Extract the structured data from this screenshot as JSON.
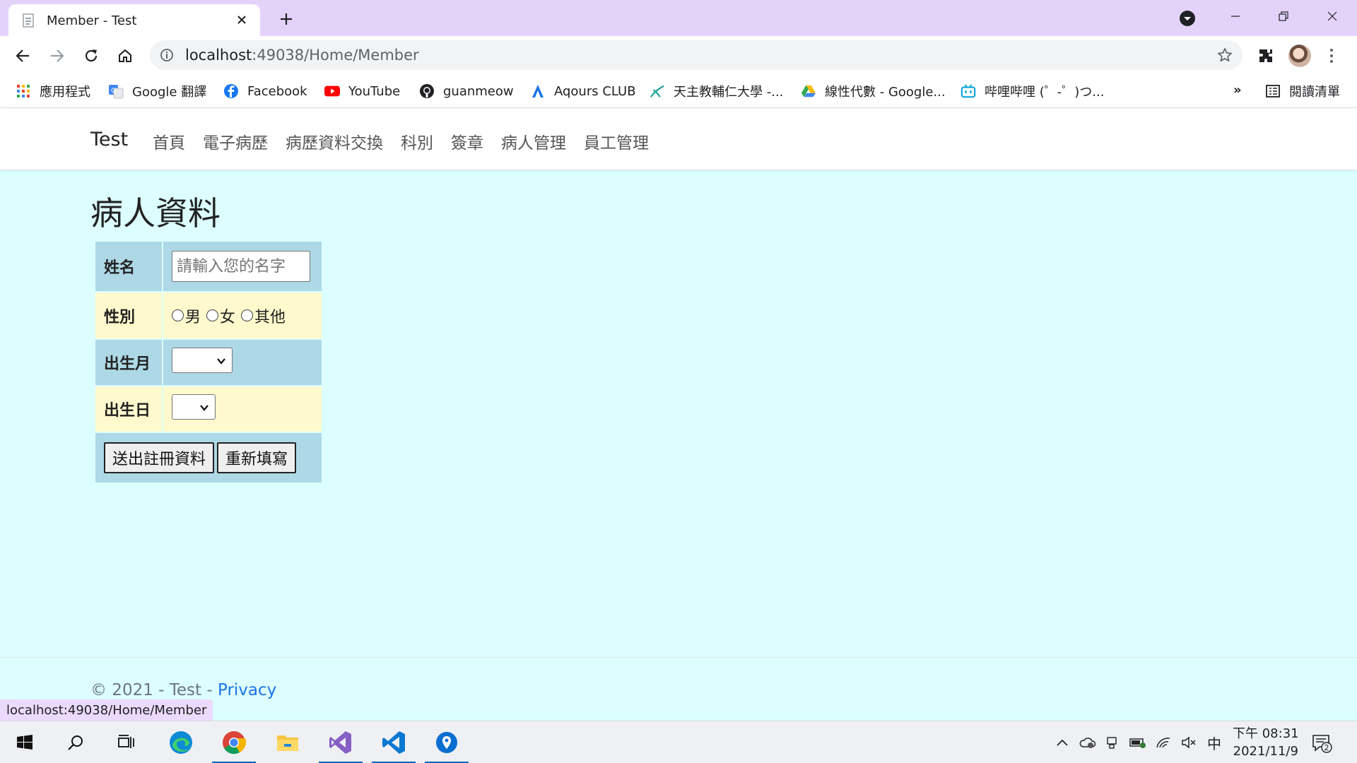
{
  "browser": {
    "tab_title": "Member - Test",
    "url_host": "localhost",
    "url_rest": ":49038/Home/Member",
    "bookmarks": [
      {
        "label": "應用程式",
        "icon": "apps-grid-icon"
      },
      {
        "label": "Google 翻譯",
        "icon": "google-translate-icon"
      },
      {
        "label": "Facebook",
        "icon": "facebook-icon"
      },
      {
        "label": "YouTube",
        "icon": "youtube-icon"
      },
      {
        "label": "guanmeow",
        "icon": "github-icon"
      },
      {
        "label": "Aqours CLUB",
        "icon": "aqours-icon"
      },
      {
        "label": "天主教輔仁大學 -...",
        "icon": "fju-icon"
      },
      {
        "label": "線性代數 - Google...",
        "icon": "google-drive-icon"
      },
      {
        "label": "哔哩哔哩 (゜-゜)つ...",
        "icon": "bilibili-icon"
      }
    ],
    "more_label": "»",
    "reading_list_label": "閱讀清單",
    "status_url": "localhost:49038/Home/Member"
  },
  "site": {
    "brand": "Test",
    "nav": [
      "首頁",
      "電子病歷",
      "病歷資料交換",
      "科別",
      "簽章",
      "病人管理",
      "員工管理"
    ]
  },
  "form": {
    "heading": "病人資料",
    "name_label": "姓名",
    "name_placeholder": "請輸入您的名字",
    "gender_label": "性別",
    "gender_options": [
      "男",
      "女",
      "其他"
    ],
    "birth_month_label": "出生月",
    "birth_day_label": "出生日",
    "submit_label": "送出註冊資料",
    "reset_label": "重新填寫"
  },
  "footer": {
    "copyright": "© 2021 - Test - ",
    "privacy_link": "Privacy"
  },
  "taskbar": {
    "ime": "中",
    "time": "下午 08:31",
    "date": "2021/11/9",
    "notification_count": "2"
  },
  "colors": {
    "page_bg": "#dcfeff",
    "row_blue": "#add8e6",
    "row_yellow": "#fffacd",
    "tab_strip": "#e3d3fa"
  }
}
